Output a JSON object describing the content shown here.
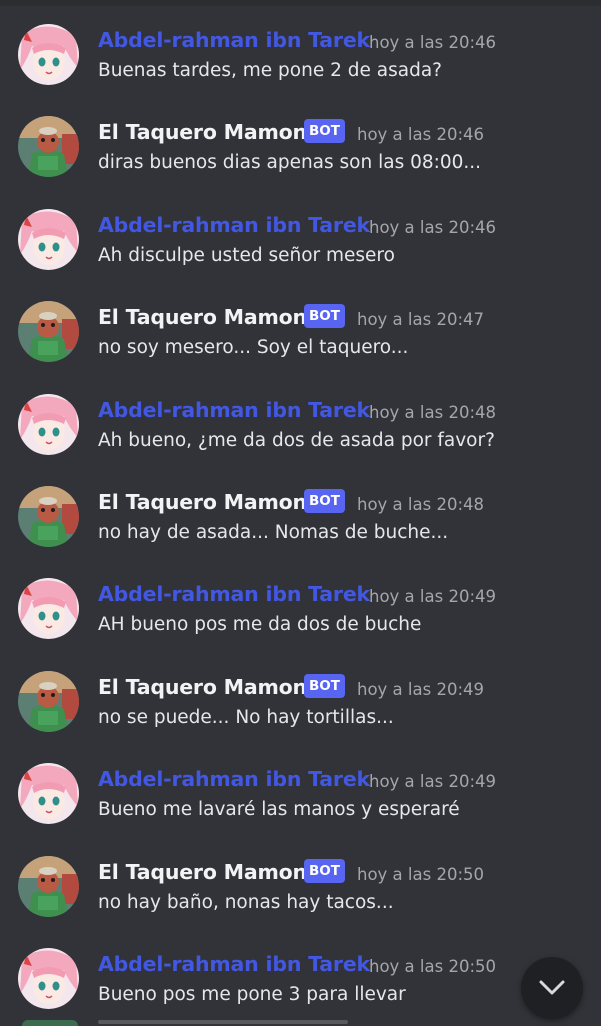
{
  "chat": {
    "messages": [
      {
        "author": "Abdel-rahman ibn Tarek",
        "kind": "user",
        "timestamp": "hoy a las 20:46",
        "text": "Buenas tardes, me pone 2 de asada?"
      },
      {
        "author": "El Taquero Mamon",
        "kind": "bot",
        "badge": "BOT",
        "timestamp": "hoy a las 20:46",
        "text": "diras buenos dias apenas son las 08:00..."
      },
      {
        "author": "Abdel-rahman ibn Tarek",
        "kind": "user",
        "timestamp": "hoy a las 20:46",
        "text": "Ah disculpe usted señor mesero"
      },
      {
        "author": "El Taquero Mamon",
        "kind": "bot",
        "badge": "BOT",
        "timestamp": "hoy a las 20:47",
        "text": "no soy mesero... Soy el taquero..."
      },
      {
        "author": "Abdel-rahman ibn Tarek",
        "kind": "user",
        "timestamp": "hoy a las 20:48",
        "text": "Ah bueno, ¿me da dos de asada por favor?"
      },
      {
        "author": "El Taquero Mamon",
        "kind": "bot",
        "badge": "BOT",
        "timestamp": "hoy a las 20:48",
        "text": "no hay de asada... Nomas de buche..."
      },
      {
        "author": "Abdel-rahman ibn Tarek",
        "kind": "user",
        "timestamp": "hoy a las 20:49",
        "text": "AH bueno pos me da dos de buche"
      },
      {
        "author": "El Taquero Mamon",
        "kind": "bot",
        "badge": "BOT",
        "timestamp": "hoy a las 20:49",
        "text": "no se puede... No hay tortillas..."
      },
      {
        "author": "Abdel-rahman ibn Tarek",
        "kind": "user",
        "timestamp": "hoy a las 20:49",
        "text": "Bueno me lavaré las manos y esperaré"
      },
      {
        "author": "El Taquero Mamon",
        "kind": "bot",
        "badge": "BOT",
        "timestamp": "hoy a las 20:50",
        "text": "no hay baño, nonas hay tacos..."
      },
      {
        "author": "Abdel-rahman ibn Tarek",
        "kind": "user",
        "timestamp": "hoy a las 20:50",
        "text": "Bueno pos me pone 3 para llevar"
      }
    ]
  },
  "scroll_button": {
    "icon": "chevron-down-icon"
  },
  "colors": {
    "background": "#313338",
    "user_name": "#4257e2",
    "bot_name": "#f2f3f5",
    "bot_badge": "#5865f2",
    "timestamp": "#a4a6ad",
    "message_text": "#e6e7ea"
  }
}
